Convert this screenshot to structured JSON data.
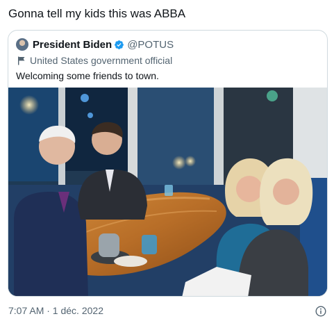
{
  "tweet": {
    "text": "Gonna tell my kids this was ABBA",
    "timestamp": "7:07 AM · 1 déc. 2022"
  },
  "quoted_tweet": {
    "author_name": "President Biden",
    "author_handle": "@POTUS",
    "account_label": "United States government official",
    "text": "Welcoming some friends to town."
  },
  "icons": {
    "verified": "verified-badge-icon",
    "label": "flag-icon",
    "info": "info-icon"
  },
  "colors": {
    "text_primary": "#0f1419",
    "text_secondary": "#536471",
    "verified_blue": "#1d9bf0",
    "card_border": "#cfd9de"
  }
}
